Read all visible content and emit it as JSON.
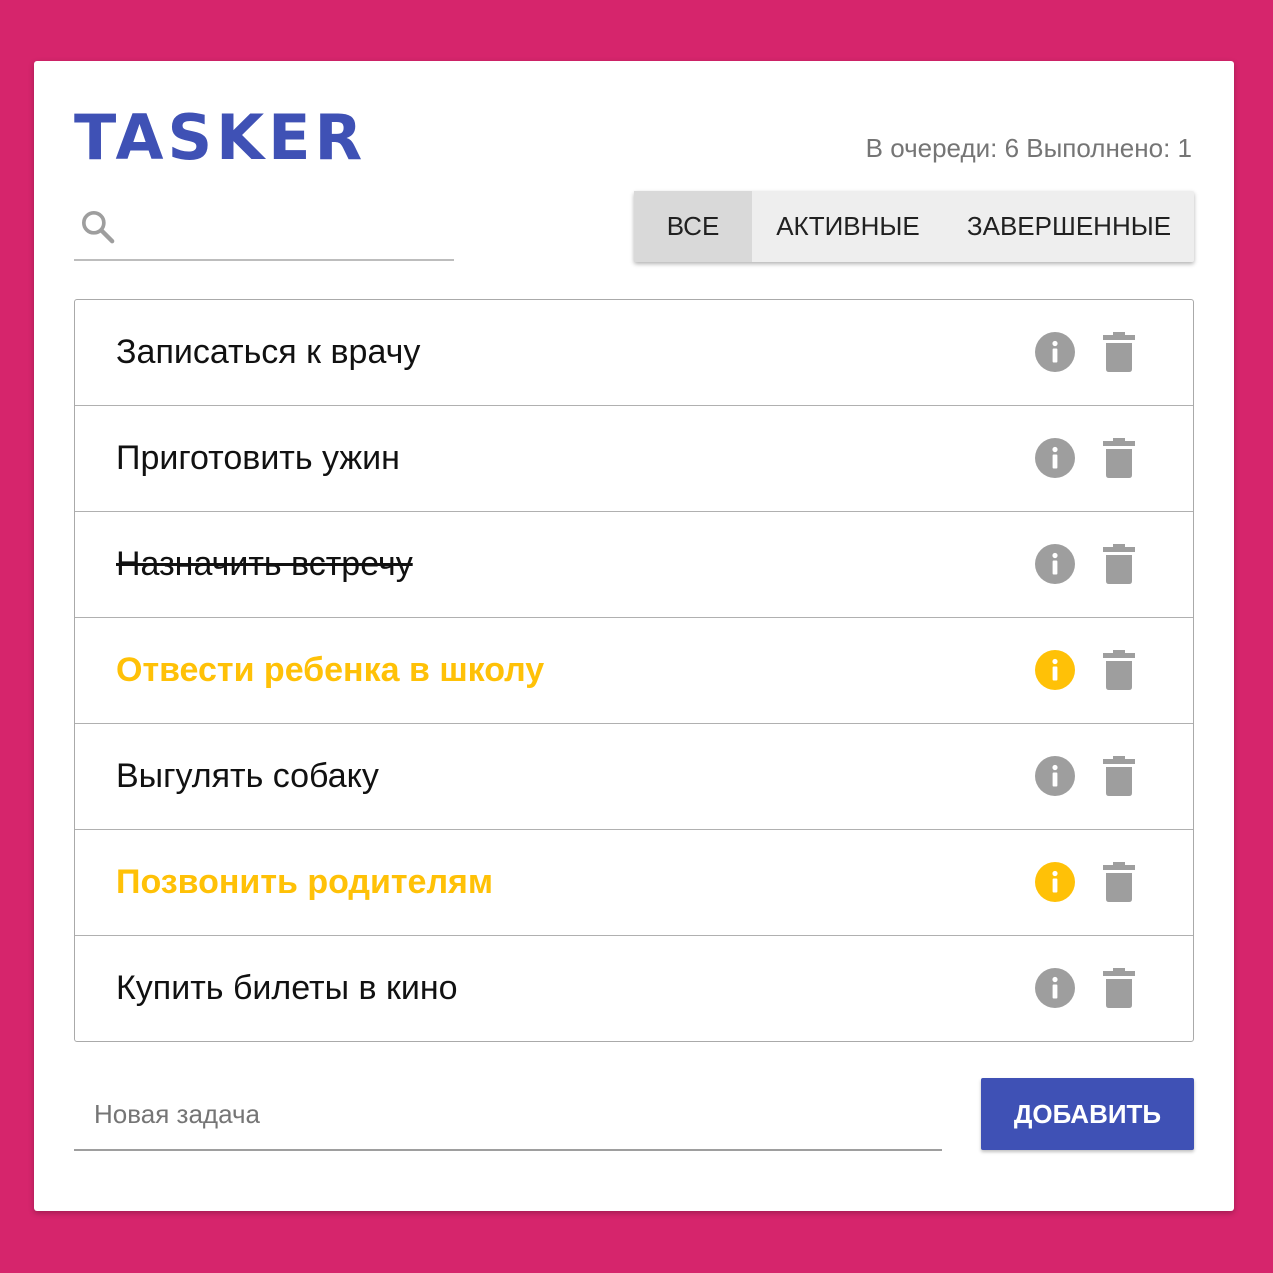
{
  "app": {
    "logo": "TASKER"
  },
  "stats": {
    "text": "В очереди: 6 Выполнено: 1"
  },
  "search": {
    "placeholder": "",
    "value": "",
    "icon": "search-icon"
  },
  "filters": [
    {
      "label": "ВСЕ",
      "active": true
    },
    {
      "label": "АКТИВНЫЕ",
      "active": false
    },
    {
      "label": "ЗАВЕРШЕННЫЕ",
      "active": false
    }
  ],
  "tasks": [
    {
      "label": "Записаться к врачу",
      "done": false,
      "important": false
    },
    {
      "label": "Приготовить ужин",
      "done": false,
      "important": false
    },
    {
      "label": "Назначить встречу",
      "done": true,
      "important": false
    },
    {
      "label": "Отвести ребенка в школу",
      "done": false,
      "important": true
    },
    {
      "label": "Выгулять собаку",
      "done": false,
      "important": false
    },
    {
      "label": "Позвонить родителям",
      "done": false,
      "important": true
    },
    {
      "label": "Купить билеты в кино",
      "done": false,
      "important": false
    }
  ],
  "new_task": {
    "placeholder": "Новая задача",
    "value": ""
  },
  "add_button": {
    "label": "ДОБАВИТЬ"
  },
  "colors": {
    "background": "#d6256c",
    "primary": "#3f51b5",
    "important": "#ffc107",
    "icon_gray": "#9e9e9e"
  }
}
